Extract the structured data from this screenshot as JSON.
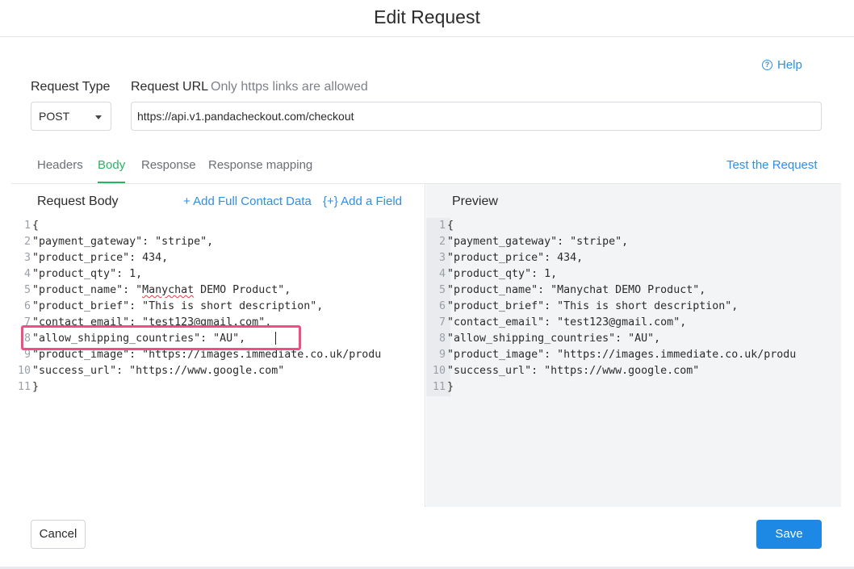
{
  "dialog": {
    "title": "Edit Request"
  },
  "help": {
    "label": "Help",
    "icon": "help-circle-icon"
  },
  "request_type": {
    "label": "Request Type",
    "value": "POST"
  },
  "request_url": {
    "label": "Request URL",
    "hint": "Only https links are allowed",
    "value": "https://api.v1.pandacheckout.com/checkout"
  },
  "tabs": [
    {
      "label": "Headers",
      "active": false
    },
    {
      "label": "Body",
      "active": true
    },
    {
      "label": "Response",
      "active": false
    },
    {
      "label": "Response mapping",
      "active": false
    }
  ],
  "test_request_label": "Test the Request",
  "request_body": {
    "title": "Request Body",
    "add_contact_label": "+ Add Full Contact Data",
    "add_field_label": "{+} Add a Field",
    "lines": [
      "{",
      "\"payment_gateway\": \"stripe\",",
      "\"product_price\": 434,",
      "\"product_qty\": 1,",
      "\"product_name\": \"Manychat DEMO Product\",",
      "\"product_brief\": \"This is short description\",",
      "\"contact_email\": \"test123@gmail.com\",",
      "\"allow_shipping_countries\": \"AU\",",
      "\"product_image\": \"https://images.immediate.co.uk/produ",
      "\"success_url\": \"https://www.google.com\"",
      "}"
    ]
  },
  "preview": {
    "title": "Preview",
    "lines": [
      "{",
      "\"payment_gateway\": \"stripe\",",
      "\"product_price\": 434,",
      "\"product_qty\": 1,",
      "\"product_name\": \"Manychat DEMO Product\",",
      "\"product_brief\": \"This is short description\",",
      "\"contact_email\": \"test123@gmail.com\",",
      "\"allow_shipping_countries\": \"AU\",",
      "\"product_image\": \"https://images.immediate.co.uk/produ",
      "\"success_url\": \"https://www.google.com\"",
      "}"
    ]
  },
  "footer": {
    "cancel_label": "Cancel",
    "save_label": "Save"
  },
  "colors": {
    "accent_blue": "#1e88e5",
    "tab_active_green": "#28b463",
    "highlight_pink": "#ee4f86"
  }
}
